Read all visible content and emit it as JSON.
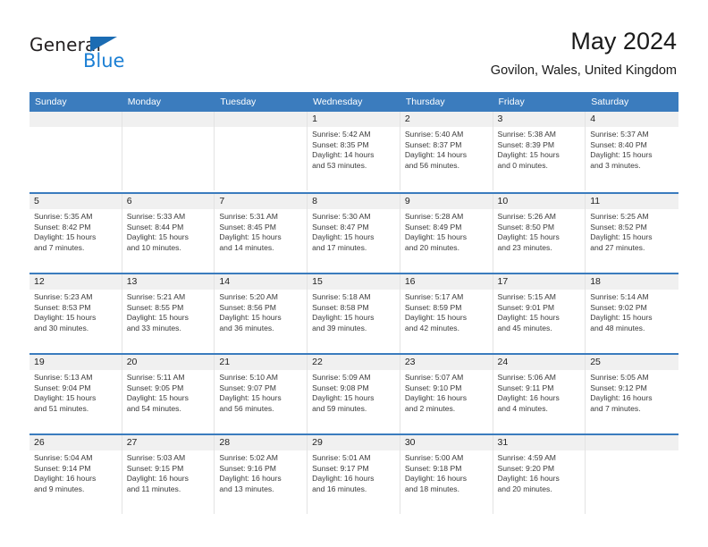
{
  "brand": {
    "name_part1": "General",
    "name_part2": "Blue",
    "triangle_color": "#1b6cb3",
    "blue_color": "#1b7fd4"
  },
  "header": {
    "title": "May 2024",
    "subtitle": "Govilon, Wales, United Kingdom"
  },
  "theme": {
    "header_blue": "#3b7cbe",
    "date_strip_gray": "#f0f0f0",
    "cell_border": "#e3e3e3"
  },
  "weekdays": [
    "Sunday",
    "Monday",
    "Tuesday",
    "Wednesday",
    "Thursday",
    "Friday",
    "Saturday"
  ],
  "weeks": [
    [
      {
        "day": "",
        "sunrise": "",
        "sunset": "",
        "daylight_line1": "",
        "daylight_line2": ""
      },
      {
        "day": "",
        "sunrise": "",
        "sunset": "",
        "daylight_line1": "",
        "daylight_line2": ""
      },
      {
        "day": "",
        "sunrise": "",
        "sunset": "",
        "daylight_line1": "",
        "daylight_line2": ""
      },
      {
        "day": "1",
        "sunrise": "Sunrise: 5:42 AM",
        "sunset": "Sunset: 8:35 PM",
        "daylight_line1": "Daylight: 14 hours",
        "daylight_line2": "and 53 minutes."
      },
      {
        "day": "2",
        "sunrise": "Sunrise: 5:40 AM",
        "sunset": "Sunset: 8:37 PM",
        "daylight_line1": "Daylight: 14 hours",
        "daylight_line2": "and 56 minutes."
      },
      {
        "day": "3",
        "sunrise": "Sunrise: 5:38 AM",
        "sunset": "Sunset: 8:39 PM",
        "daylight_line1": "Daylight: 15 hours",
        "daylight_line2": "and 0 minutes."
      },
      {
        "day": "4",
        "sunrise": "Sunrise: 5:37 AM",
        "sunset": "Sunset: 8:40 PM",
        "daylight_line1": "Daylight: 15 hours",
        "daylight_line2": "and 3 minutes."
      }
    ],
    [
      {
        "day": "5",
        "sunrise": "Sunrise: 5:35 AM",
        "sunset": "Sunset: 8:42 PM",
        "daylight_line1": "Daylight: 15 hours",
        "daylight_line2": "and 7 minutes."
      },
      {
        "day": "6",
        "sunrise": "Sunrise: 5:33 AM",
        "sunset": "Sunset: 8:44 PM",
        "daylight_line1": "Daylight: 15 hours",
        "daylight_line2": "and 10 minutes."
      },
      {
        "day": "7",
        "sunrise": "Sunrise: 5:31 AM",
        "sunset": "Sunset: 8:45 PM",
        "daylight_line1": "Daylight: 15 hours",
        "daylight_line2": "and 14 minutes."
      },
      {
        "day": "8",
        "sunrise": "Sunrise: 5:30 AM",
        "sunset": "Sunset: 8:47 PM",
        "daylight_line1": "Daylight: 15 hours",
        "daylight_line2": "and 17 minutes."
      },
      {
        "day": "9",
        "sunrise": "Sunrise: 5:28 AM",
        "sunset": "Sunset: 8:49 PM",
        "daylight_line1": "Daylight: 15 hours",
        "daylight_line2": "and 20 minutes."
      },
      {
        "day": "10",
        "sunrise": "Sunrise: 5:26 AM",
        "sunset": "Sunset: 8:50 PM",
        "daylight_line1": "Daylight: 15 hours",
        "daylight_line2": "and 23 minutes."
      },
      {
        "day": "11",
        "sunrise": "Sunrise: 5:25 AM",
        "sunset": "Sunset: 8:52 PM",
        "daylight_line1": "Daylight: 15 hours",
        "daylight_line2": "and 27 minutes."
      }
    ],
    [
      {
        "day": "12",
        "sunrise": "Sunrise: 5:23 AM",
        "sunset": "Sunset: 8:53 PM",
        "daylight_line1": "Daylight: 15 hours",
        "daylight_line2": "and 30 minutes."
      },
      {
        "day": "13",
        "sunrise": "Sunrise: 5:21 AM",
        "sunset": "Sunset: 8:55 PM",
        "daylight_line1": "Daylight: 15 hours",
        "daylight_line2": "and 33 minutes."
      },
      {
        "day": "14",
        "sunrise": "Sunrise: 5:20 AM",
        "sunset": "Sunset: 8:56 PM",
        "daylight_line1": "Daylight: 15 hours",
        "daylight_line2": "and 36 minutes."
      },
      {
        "day": "15",
        "sunrise": "Sunrise: 5:18 AM",
        "sunset": "Sunset: 8:58 PM",
        "daylight_line1": "Daylight: 15 hours",
        "daylight_line2": "and 39 minutes."
      },
      {
        "day": "16",
        "sunrise": "Sunrise: 5:17 AM",
        "sunset": "Sunset: 8:59 PM",
        "daylight_line1": "Daylight: 15 hours",
        "daylight_line2": "and 42 minutes."
      },
      {
        "day": "17",
        "sunrise": "Sunrise: 5:15 AM",
        "sunset": "Sunset: 9:01 PM",
        "daylight_line1": "Daylight: 15 hours",
        "daylight_line2": "and 45 minutes."
      },
      {
        "day": "18",
        "sunrise": "Sunrise: 5:14 AM",
        "sunset": "Sunset: 9:02 PM",
        "daylight_line1": "Daylight: 15 hours",
        "daylight_line2": "and 48 minutes."
      }
    ],
    [
      {
        "day": "19",
        "sunrise": "Sunrise: 5:13 AM",
        "sunset": "Sunset: 9:04 PM",
        "daylight_line1": "Daylight: 15 hours",
        "daylight_line2": "and 51 minutes."
      },
      {
        "day": "20",
        "sunrise": "Sunrise: 5:11 AM",
        "sunset": "Sunset: 9:05 PM",
        "daylight_line1": "Daylight: 15 hours",
        "daylight_line2": "and 54 minutes."
      },
      {
        "day": "21",
        "sunrise": "Sunrise: 5:10 AM",
        "sunset": "Sunset: 9:07 PM",
        "daylight_line1": "Daylight: 15 hours",
        "daylight_line2": "and 56 minutes."
      },
      {
        "day": "22",
        "sunrise": "Sunrise: 5:09 AM",
        "sunset": "Sunset: 9:08 PM",
        "daylight_line1": "Daylight: 15 hours",
        "daylight_line2": "and 59 minutes."
      },
      {
        "day": "23",
        "sunrise": "Sunrise: 5:07 AM",
        "sunset": "Sunset: 9:10 PM",
        "daylight_line1": "Daylight: 16 hours",
        "daylight_line2": "and 2 minutes."
      },
      {
        "day": "24",
        "sunrise": "Sunrise: 5:06 AM",
        "sunset": "Sunset: 9:11 PM",
        "daylight_line1": "Daylight: 16 hours",
        "daylight_line2": "and 4 minutes."
      },
      {
        "day": "25",
        "sunrise": "Sunrise: 5:05 AM",
        "sunset": "Sunset: 9:12 PM",
        "daylight_line1": "Daylight: 16 hours",
        "daylight_line2": "and 7 minutes."
      }
    ],
    [
      {
        "day": "26",
        "sunrise": "Sunrise: 5:04 AM",
        "sunset": "Sunset: 9:14 PM",
        "daylight_line1": "Daylight: 16 hours",
        "daylight_line2": "and 9 minutes."
      },
      {
        "day": "27",
        "sunrise": "Sunrise: 5:03 AM",
        "sunset": "Sunset: 9:15 PM",
        "daylight_line1": "Daylight: 16 hours",
        "daylight_line2": "and 11 minutes."
      },
      {
        "day": "28",
        "sunrise": "Sunrise: 5:02 AM",
        "sunset": "Sunset: 9:16 PM",
        "daylight_line1": "Daylight: 16 hours",
        "daylight_line2": "and 13 minutes."
      },
      {
        "day": "29",
        "sunrise": "Sunrise: 5:01 AM",
        "sunset": "Sunset: 9:17 PM",
        "daylight_line1": "Daylight: 16 hours",
        "daylight_line2": "and 16 minutes."
      },
      {
        "day": "30",
        "sunrise": "Sunrise: 5:00 AM",
        "sunset": "Sunset: 9:18 PM",
        "daylight_line1": "Daylight: 16 hours",
        "daylight_line2": "and 18 minutes."
      },
      {
        "day": "31",
        "sunrise": "Sunrise: 4:59 AM",
        "sunset": "Sunset: 9:20 PM",
        "daylight_line1": "Daylight: 16 hours",
        "daylight_line2": "and 20 minutes."
      },
      {
        "day": "",
        "sunrise": "",
        "sunset": "",
        "daylight_line1": "",
        "daylight_line2": ""
      }
    ]
  ]
}
